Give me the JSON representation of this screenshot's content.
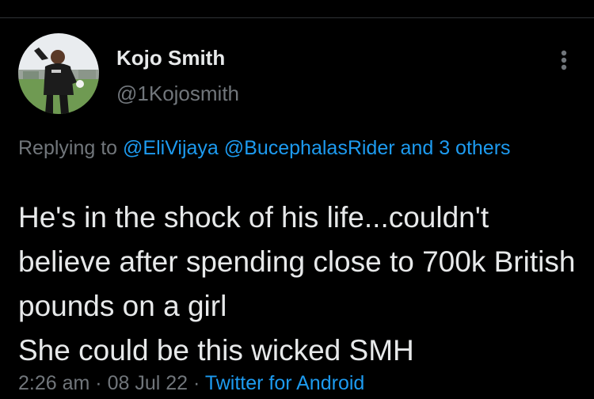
{
  "author": {
    "display_name": "Kojo Smith",
    "handle": "@1Kojosmith",
    "avatar": "profile-photo"
  },
  "header": {
    "menu_icon": "more-vertical-icon"
  },
  "reply": {
    "prefix": "Replying to",
    "mention_1": "@EliVijaya",
    "mention_2": "@BucephalasRider",
    "and": "and",
    "others": "3 others"
  },
  "tweet": {
    "text": "He's in the shock of his life...couldn't believe after spending close to 700k British pounds on a girl\nShe could be this wicked SMH"
  },
  "meta": {
    "time": "2:26 am",
    "separator": "·",
    "date": "08 Jul 22",
    "source": "Twitter for Android"
  },
  "colors": {
    "background": "#000000",
    "primary_text": "#e7e9ea",
    "secondary_text": "#71767b",
    "link": "#1d9bf0",
    "divider": "#2f3336"
  }
}
